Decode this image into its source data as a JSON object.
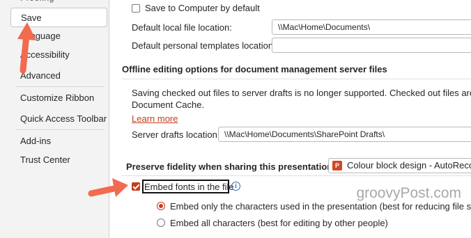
{
  "sidebar": {
    "items": [
      {
        "label": "Proofing"
      },
      {
        "label": "Save",
        "selected": true
      },
      {
        "label": "Language"
      },
      {
        "label": "Accessibility"
      },
      {
        "label": "Advanced"
      },
      {
        "label": "Customize Ribbon"
      },
      {
        "label": "Quick Access Toolbar"
      },
      {
        "label": "Add-ins"
      },
      {
        "label": "Trust Center"
      }
    ]
  },
  "save": {
    "save_to_computer_label": "Save to Computer by default",
    "save_to_computer_checked": false,
    "default_local_label": "Default local file location:",
    "default_local_value": "\\\\Mac\\Home\\Documents\\",
    "default_templates_label": "Default personal templates location:",
    "default_templates_value": ""
  },
  "offline": {
    "heading": "Offline editing options for document management server files",
    "notice_line1": "Saving checked out files to server drafts is no longer supported. Checked out files are now",
    "notice_line2": "Document Cache.",
    "learn_more": "Learn more",
    "server_drafts_label": "Server drafts location:",
    "server_drafts_value": "\\\\Mac\\Home\\Documents\\SharePoint Drafts\\"
  },
  "fidelity": {
    "heading": "Preserve fidelity when sharing this presentation:",
    "presentation": "Colour block design  -  AutoReco",
    "embed_fonts_label": "Embed fonts in the file",
    "embed_fonts_checked": true,
    "option_only_used": "Embed only the characters used in the presentation (best for reducing file size)",
    "option_all": "Embed all characters (best for editing by other people)",
    "selected_option": "only_used"
  },
  "watermark": "groovyPost.com",
  "colors": {
    "accent": "#c43e1c",
    "annotation_arrow": "#f26a4f"
  }
}
